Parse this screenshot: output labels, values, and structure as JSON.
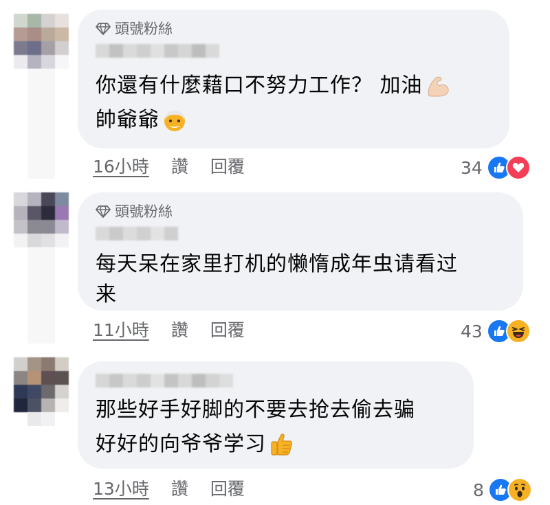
{
  "comments": [
    {
      "badge": "頭號粉絲",
      "text_lines": [
        "你還有什麼藉口不努力工作？ 加油",
        "帥爺爺"
      ],
      "time": "16小時",
      "like_label": "讚",
      "reply_label": "回覆",
      "reaction_count": "34",
      "reactions": [
        "like-icon",
        "love-icon"
      ],
      "inline_emojis": [
        "flexed-biceps-emoji",
        "old-man-emoji"
      ]
    },
    {
      "badge": "頭號粉絲",
      "text_lines": [
        "每天呆在家里打机的懒惰成年虫请看过",
        "来"
      ],
      "time": "11小時",
      "like_label": "讚",
      "reply_label": "回覆",
      "reaction_count": "43",
      "reactions": [
        "like-icon",
        "haha-icon"
      ]
    },
    {
      "text_lines": [
        "那些好手好脚的不要去抢去偷去骗",
        "好好的向爷爷学习"
      ],
      "time": "13小時",
      "like_label": "讚",
      "reply_label": "回覆",
      "reaction_count": "8",
      "reactions": [
        "like-icon",
        "wow-icon"
      ],
      "inline_emojis": [
        "thumbs-up-emoji"
      ]
    }
  ],
  "colors": {
    "bubble": "#f0f2f5",
    "meta_text": "#65676b",
    "like_blue": "#1877f2",
    "love_red": "#f33e58",
    "emoji_yellow": "#f7b125"
  }
}
